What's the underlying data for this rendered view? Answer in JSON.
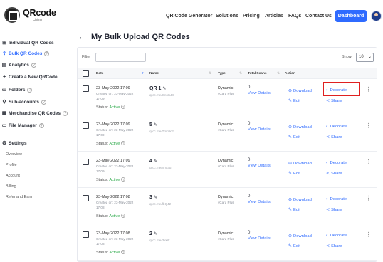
{
  "header": {
    "logo_text": "QRcode",
    "logo_sub": "Chimp",
    "nav": [
      "QR Code Generator",
      "Solutions",
      "Pricing",
      "Articles",
      "FAQs",
      "Contact Us"
    ],
    "dashboard_label": "Dashboard"
  },
  "sidebar": {
    "items": [
      {
        "icon": "qr-grid-icon",
        "glyph": "⊞",
        "label": "Individual QR Codes"
      },
      {
        "icon": "upload-icon",
        "glyph": "⇪",
        "label": "Bulk QR Codes"
      },
      {
        "icon": "analytics-icon",
        "glyph": "▤",
        "label": "Analytics"
      },
      {
        "icon": "plus-icon",
        "glyph": "+",
        "label": "Create a New QRCode"
      },
      {
        "icon": "folder-icon",
        "glyph": "▭",
        "label": "Folders"
      },
      {
        "icon": "user-icon",
        "glyph": "⚲",
        "label": "Sub-accounts"
      },
      {
        "icon": "store-icon",
        "glyph": "▦",
        "label": "Merchandise QR Codes"
      },
      {
        "icon": "file-icon",
        "glyph": "▭",
        "label": "File Manager"
      }
    ],
    "settings_label": "Settings",
    "settings_glyph": "⚙",
    "settings_sub": [
      "Overview",
      "Profile",
      "Account",
      "Billing",
      "Refer and Earn"
    ],
    "help_glyph": "?"
  },
  "page": {
    "back_glyph": "←",
    "title": "My Bulk Upload QR Codes"
  },
  "table": {
    "filter_label": "Filter",
    "filter_value": "",
    "show_label": "Show",
    "show_value": "10",
    "columns": [
      "Date",
      "Name",
      "Type",
      "Total Scans",
      "Action"
    ],
    "rows": [
      {
        "date": "23-May-2022 17:09",
        "created": "Created on: 23-May-2022 17:09",
        "status_label": "Status:",
        "status": "Active",
        "name": "QR 1",
        "link": "qrcc.me/CnnKJ8",
        "type": "Dynamic",
        "subtype": "vCard Plus",
        "scans": "0",
        "view": "View Details",
        "download": "Download",
        "decorate": "Decorate",
        "edit": "Edit",
        "share": "Share"
      },
      {
        "date": "23-May-2022 17:09",
        "created": "Created on: 23-May-2022 17:09",
        "status_label": "Status:",
        "status": "Active",
        "name": "5",
        "link": "qrcc.me/TmmKE",
        "type": "Dynamic",
        "subtype": "vCard Plus",
        "scans": "0",
        "view": "View Details",
        "download": "Download",
        "decorate": "Decorate",
        "edit": "Edit",
        "share": "Share"
      },
      {
        "date": "23-May-2022 17:09",
        "created": "Created on: 23-May-2022 17:09",
        "status_label": "Status:",
        "status": "Active",
        "name": "4",
        "link": "qrcc.me/nn03g",
        "type": "Dynamic",
        "subtype": "vCard Plus",
        "scans": "0",
        "view": "View Details",
        "download": "Download",
        "decorate": "Decorate",
        "edit": "Edit",
        "share": "Share"
      },
      {
        "date": "23-May-2022 17:08",
        "created": "Created on: 23-May-2022 17:08",
        "status_label": "Status:",
        "status": "Active",
        "name": "3",
        "link": "qrcc.me/fbQ42",
        "type": "Dynamic",
        "subtype": "vCard Plus",
        "scans": "0",
        "view": "View Details",
        "download": "Download",
        "decorate": "Decorate",
        "edit": "Edit",
        "share": "Share"
      },
      {
        "date": "23-May-2022 17:08",
        "created": "Created on: 23-May-2022 17:08",
        "status_label": "Status:",
        "status": "Active",
        "name": "2",
        "link": "qrcc.me/3kkrk",
        "type": "Dynamic",
        "subtype": "vCard Plus",
        "scans": "0",
        "view": "View Details",
        "download": "Download",
        "decorate": "Decorate",
        "edit": "Edit",
        "share": "Share"
      }
    ]
  },
  "colors": {
    "accent": "#2f6bff",
    "active_status": "#27a745",
    "highlight_box": "#e02020"
  }
}
